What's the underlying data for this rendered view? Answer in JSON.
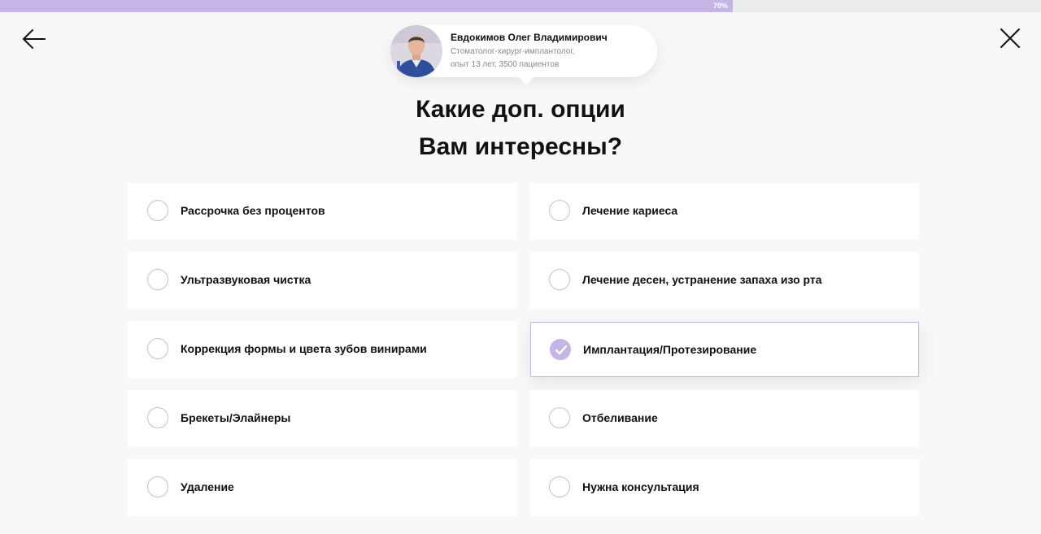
{
  "progress": {
    "label": "70%",
    "value": 0.7
  },
  "navigation": {
    "back_icon": "arrow-left-icon",
    "close_icon": "close-icon"
  },
  "doctor": {
    "name": "Евдокимов Олег Владимирович",
    "description_line1": "Стоматолог-хирург-имплантолог,",
    "description_line2": "опыт 13 лет, 3500 пациентов"
  },
  "question": {
    "title_line1": "Какие доп. опции",
    "title_line2": "Вам интересны?"
  },
  "options": [
    {
      "label": "Рассрочка без процентов",
      "selected": false
    },
    {
      "label": "Лечение кариеса",
      "selected": false
    },
    {
      "label": "Ультразвуковая чистка",
      "selected": false
    },
    {
      "label": "Лечение десен, устранение запаха изо рта",
      "selected": false
    },
    {
      "label": "Коррекция формы и цвета зубов винирами",
      "selected": false
    },
    {
      "label": "Имплантация/Протезирование",
      "selected": true
    },
    {
      "label": "Брекеты/Элайнеры",
      "selected": false
    },
    {
      "label": "Отбеливание",
      "selected": false
    },
    {
      "label": "Удаление",
      "selected": false
    },
    {
      "label": "Нужна консультация",
      "selected": false
    }
  ],
  "colors": {
    "accent": "#c4b5e6",
    "background": "#f8f8f8",
    "card": "#ffffff",
    "text": "#111111",
    "muted": "#888888"
  }
}
